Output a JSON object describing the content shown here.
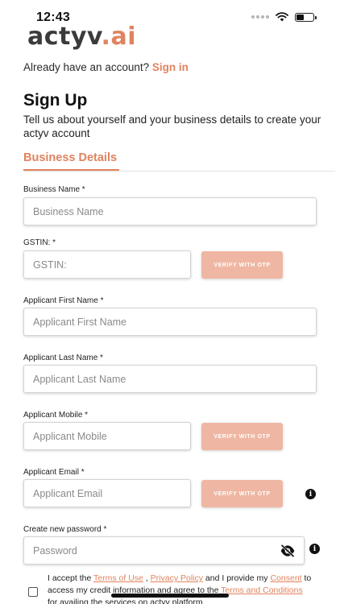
{
  "status_bar": {
    "time": "12:43"
  },
  "brand": {
    "logo_main": "actyv",
    "logo_dot": ".",
    "logo_suffix": "ai",
    "accent_color": "#e0835f",
    "button_color": "#efb7a3"
  },
  "header": {
    "signin_prompt": "Already have an account?",
    "signin_link": "Sign in",
    "title": "Sign Up",
    "subtitle": "Tell us about yourself and your business details to create your actyv account"
  },
  "tabs": [
    {
      "label": "Business Details",
      "active": true
    }
  ],
  "form": {
    "business_name": {
      "label": "Business Name *",
      "placeholder": "Business Name"
    },
    "gstin": {
      "label": "GSTIN: *",
      "placeholder": "GSTIN:",
      "verify_label": "VERIFY WITH OTP"
    },
    "first_name": {
      "label": "Applicant First Name *",
      "placeholder": "Applicant First Name"
    },
    "last_name": {
      "label": "Applicant Last Name *",
      "placeholder": "Applicant Last Name"
    },
    "mobile": {
      "label": "Applicant Mobile *",
      "placeholder": "Applicant Mobile",
      "verify_label": "VERIFY WITH OTP"
    },
    "email": {
      "label": "Applicant Email *",
      "placeholder": "Applicant Email",
      "verify_label": "VERIFY WITH OTP"
    },
    "password": {
      "label": "Create new password *",
      "placeholder": "Password"
    }
  },
  "terms": {
    "part1": "I accept the ",
    "terms_of_use": "Terms of Use",
    "part2": " , ",
    "privacy_policy": "Privacy Policy",
    "part3": " and I provide my ",
    "consent": "Consent",
    "part4": " to access my credit information and agree to the ",
    "terms_and_conditions": "Terms and Conditions",
    "part5": " for availing the services on actyv platform"
  },
  "icons": [
    "wifi-icon",
    "battery-icon",
    "info-icon",
    "eye-off-icon",
    "checkbox-icon"
  ]
}
